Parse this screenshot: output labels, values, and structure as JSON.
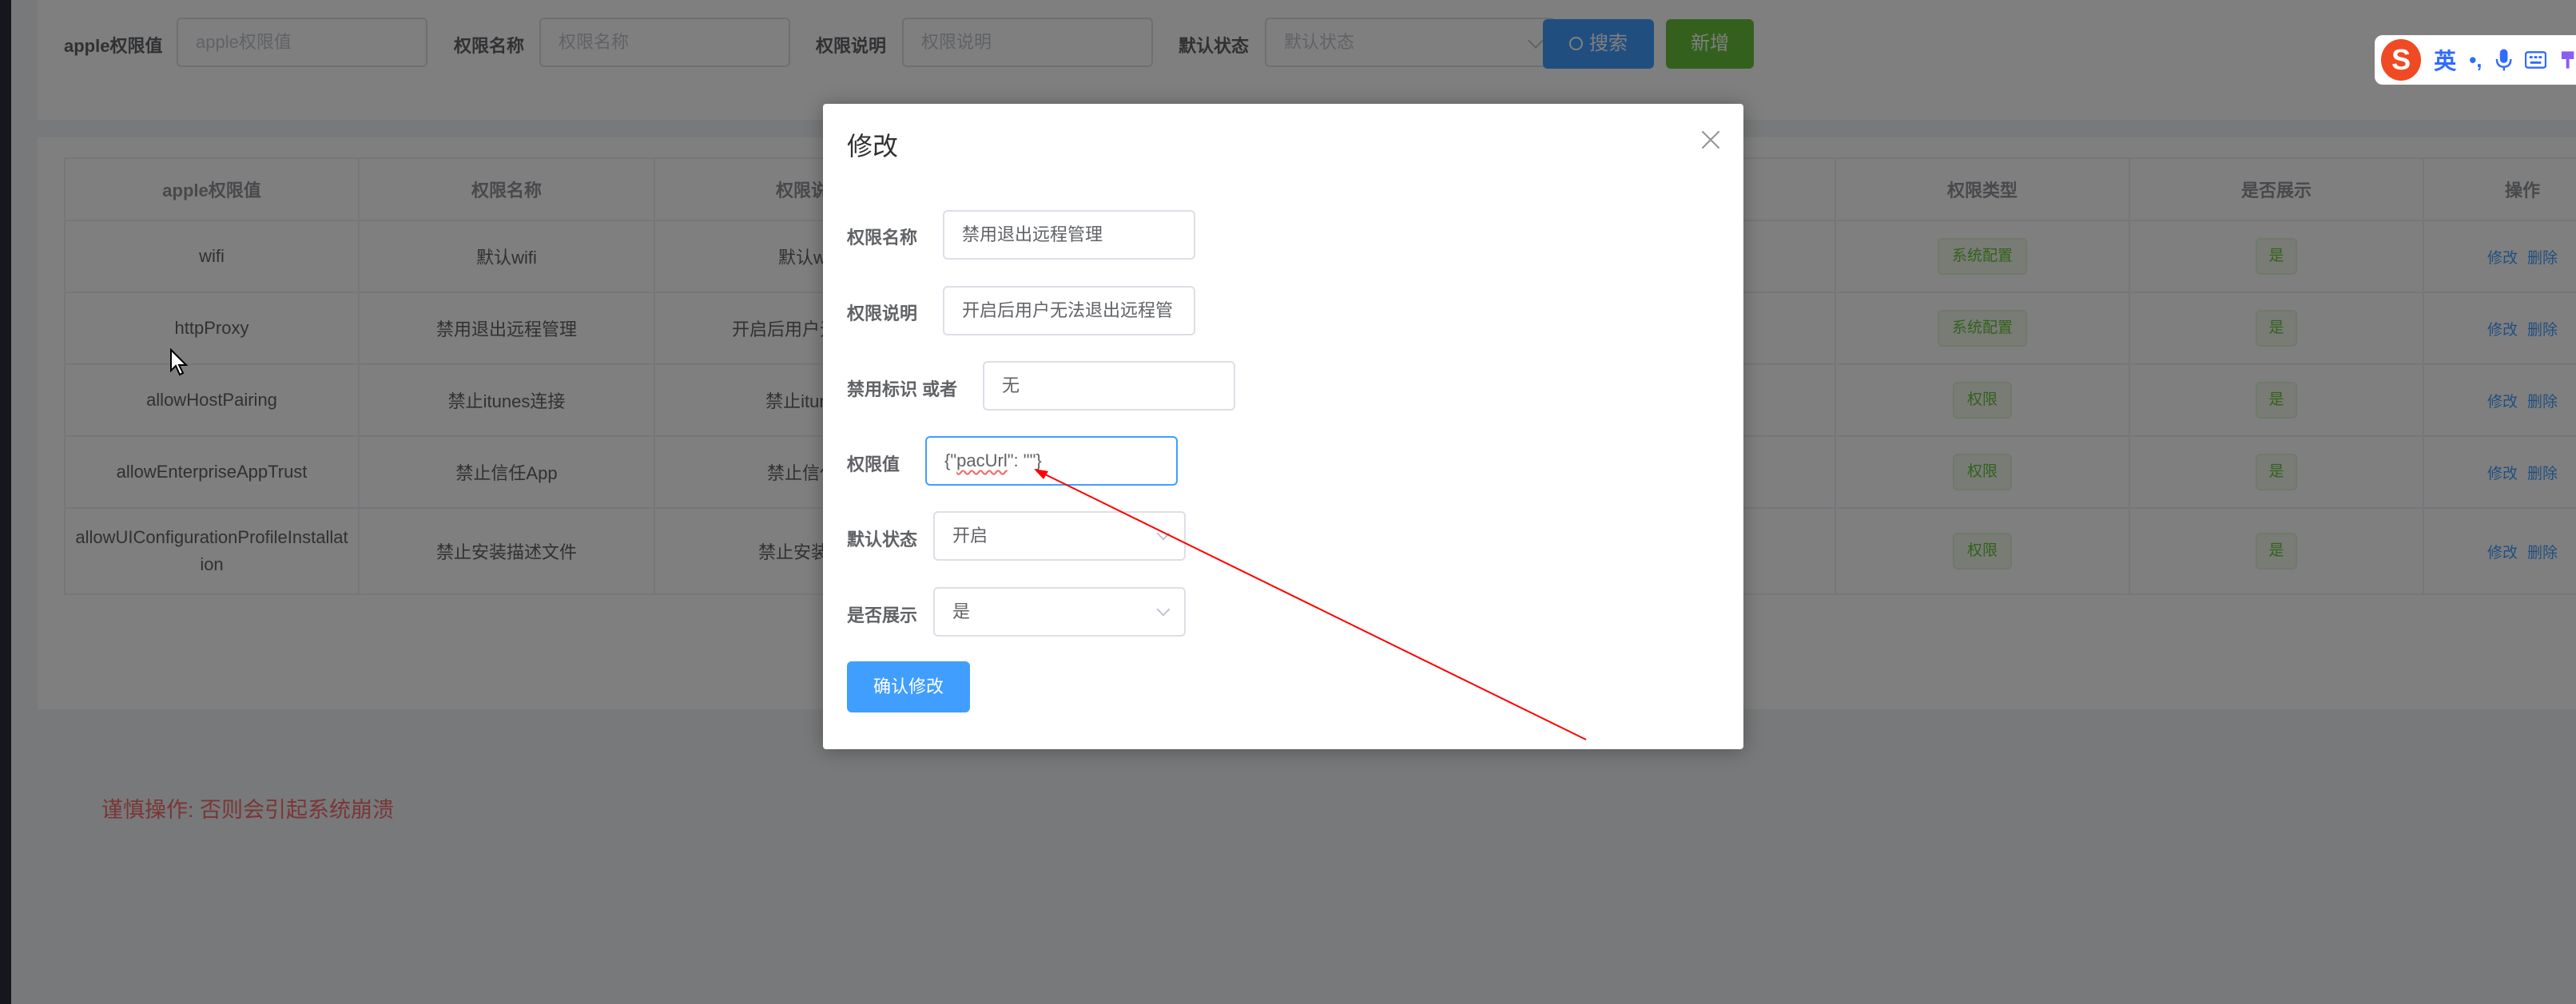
{
  "search": {
    "fields": [
      {
        "label": "apple权限值",
        "placeholder": "apple权限值"
      },
      {
        "label": "权限名称",
        "placeholder": "权限名称"
      },
      {
        "label": "权限说明",
        "placeholder": "权限说明"
      },
      {
        "label": "默认状态",
        "placeholder": "默认状态"
      }
    ],
    "search_button": "搜索",
    "add_button": "新增"
  },
  "table": {
    "headers": [
      "apple权限值",
      "权限名称",
      "权限说",
      "权限类型",
      "是否展示",
      "操作"
    ],
    "rows": [
      {
        "value": "wifi",
        "name": "默认wifi",
        "desc": "默认w",
        "type": "系统配置",
        "show": "是"
      },
      {
        "value": "httpProxy",
        "name": "禁用退出远程管理",
        "desc": "开启后用户无法退",
        "type": "系统配置",
        "show": "是"
      },
      {
        "value": "allowHostPairing",
        "name": "禁止itunes连接",
        "desc": "禁止itune",
        "type": "权限",
        "show": "是"
      },
      {
        "value": "allowEnterpriseAppTrust",
        "name": "禁止信任App",
        "desc": "禁止信任",
        "type": "权限",
        "show": "是"
      },
      {
        "value": "allowUIConfigurationProfileInstallation",
        "name": "禁止安装描述文件",
        "desc": "禁止安装描",
        "type": "权限",
        "show": "是"
      }
    ],
    "edit_link": "修改",
    "delete_link": "删除"
  },
  "warning": "谨慎操作:  否则会引起系统崩溃",
  "ime": {
    "lang": "英"
  },
  "dialog": {
    "title": "修改",
    "fields": {
      "name": {
        "label": "权限名称",
        "value": "禁用退出远程管理"
      },
      "desc": {
        "label": "权限说明",
        "value": "开启后用户无法退出远程管"
      },
      "ban": {
        "label": "禁用标识 或者",
        "value": "无"
      },
      "perm_value": {
        "label": "权限值",
        "value_prefix": "{\"",
        "value_word": "pacUrl",
        "value_suffix": "\": \"\"}"
      },
      "default_state": {
        "label": "默认状态",
        "value": "开启"
      },
      "show": {
        "label": "是否展示",
        "value": "是"
      }
    },
    "confirm_button": "确认修改"
  },
  "colors": {
    "primary": "#409eff",
    "success": "#67c23a",
    "danger": "#f56c6c",
    "annotation": "#ff0000"
  }
}
